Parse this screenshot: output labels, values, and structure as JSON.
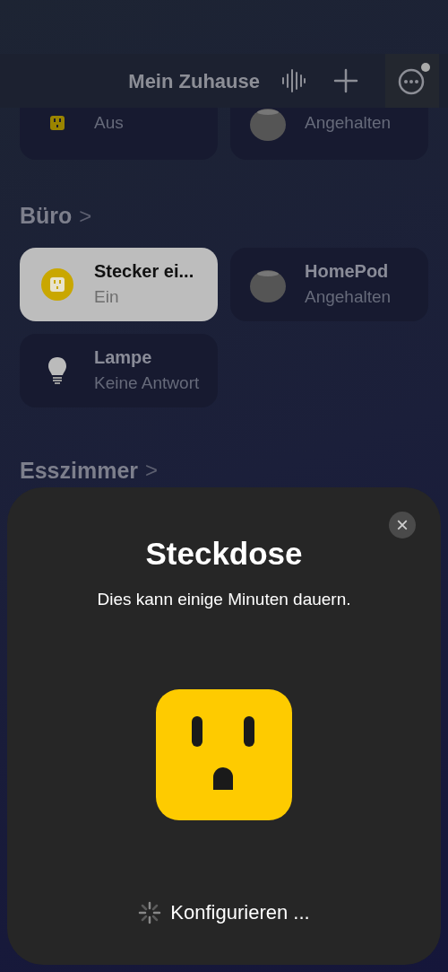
{
  "header": {
    "title": "Mein Zuhause",
    "has_notification": true
  },
  "top_tiles": [
    {
      "status": "Aus",
      "kind": "plug",
      "on": false
    },
    {
      "status": "Angehalten",
      "kind": "speaker",
      "on": false
    }
  ],
  "rooms": [
    {
      "name": "Büro",
      "chevron": ">",
      "tiles": [
        {
          "name": "Stecker ei...",
          "status": "Ein",
          "kind": "plug",
          "on": true
        },
        {
          "name": "HomePod",
          "status": "Angehalten",
          "kind": "speaker",
          "on": false
        },
        {
          "name": "Lampe",
          "status": "Keine Antwort",
          "kind": "bulb",
          "on": false
        }
      ]
    },
    {
      "name": "Esszimmer",
      "chevron": ">"
    }
  ],
  "sheet": {
    "title": "Steckdose",
    "subtitle": "Dies kann einige Minuten dauern.",
    "close": "×",
    "status": "Konfigurieren ..."
  }
}
